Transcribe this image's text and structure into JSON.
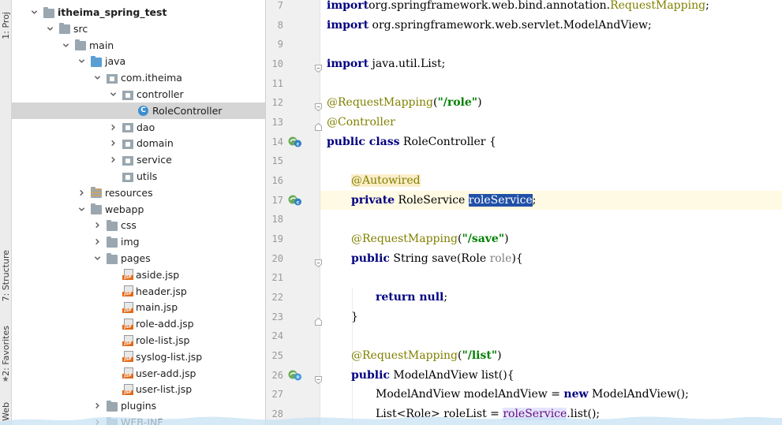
{
  "toolstrip": {
    "project_tab": "1: Proj",
    "structure_tab": "7: Structure",
    "favorites_tab": "2: Favorites",
    "web_tab": "Web"
  },
  "tree": {
    "items": [
      {
        "label": "itheima_spring_test",
        "level": 0,
        "chevron": "down",
        "icon": "module-folder",
        "bold": true
      },
      {
        "label": "src",
        "level": 1,
        "chevron": "down",
        "icon": "folder"
      },
      {
        "label": "main",
        "level": 2,
        "chevron": "down",
        "icon": "folder"
      },
      {
        "label": "java",
        "level": 3,
        "chevron": "down",
        "icon": "source-folder"
      },
      {
        "label": "com.itheima",
        "level": 4,
        "chevron": "down",
        "icon": "package"
      },
      {
        "label": "controller",
        "level": 5,
        "chevron": "down",
        "icon": "package"
      },
      {
        "label": "RoleController",
        "level": 6,
        "chevron": "none",
        "icon": "class",
        "selected": true
      },
      {
        "label": "dao",
        "level": 5,
        "chevron": "right",
        "icon": "package"
      },
      {
        "label": "domain",
        "level": 5,
        "chevron": "right",
        "icon": "package"
      },
      {
        "label": "service",
        "level": 5,
        "chevron": "right",
        "icon": "package"
      },
      {
        "label": "utils",
        "level": 5,
        "chevron": "none",
        "icon": "package"
      },
      {
        "label": "resources",
        "level": 3,
        "chevron": "right",
        "icon": "resources-folder"
      },
      {
        "label": "webapp",
        "level": 3,
        "chevron": "down",
        "icon": "web-folder"
      },
      {
        "label": "css",
        "level": 4,
        "chevron": "right",
        "icon": "folder"
      },
      {
        "label": "img",
        "level": 4,
        "chevron": "right",
        "icon": "folder"
      },
      {
        "label": "pages",
        "level": 4,
        "chevron": "down",
        "icon": "folder"
      },
      {
        "label": "aside.jsp",
        "level": 5,
        "chevron": "none",
        "icon": "jsp"
      },
      {
        "label": "header.jsp",
        "level": 5,
        "chevron": "none",
        "icon": "jsp"
      },
      {
        "label": "main.jsp",
        "level": 5,
        "chevron": "none",
        "icon": "jsp"
      },
      {
        "label": "role-add.jsp",
        "level": 5,
        "chevron": "none",
        "icon": "jsp"
      },
      {
        "label": "role-list.jsp",
        "level": 5,
        "chevron": "none",
        "icon": "jsp"
      },
      {
        "label": "syslog-list.jsp",
        "level": 5,
        "chevron": "none",
        "icon": "jsp"
      },
      {
        "label": "user-add.jsp",
        "level": 5,
        "chevron": "none",
        "icon": "jsp"
      },
      {
        "label": "user-list.jsp",
        "level": 5,
        "chevron": "none",
        "icon": "jsp"
      },
      {
        "label": "plugins",
        "level": 4,
        "chevron": "right",
        "icon": "folder"
      },
      {
        "label": "WEB-INF",
        "level": 4,
        "chevron": "right",
        "icon": "folder"
      }
    ]
  },
  "editor": {
    "lines": [
      {
        "n": "7",
        "indent": 0,
        "tokens": [
          [
            "kw",
            "import"
          ],
          [
            "",
            "org.springframework.web.bind.annotation."
          ],
          [
            "ann",
            "RequestMapping"
          ],
          [
            "",
            ";"
          ]
        ]
      },
      {
        "n": "8",
        "indent": 0,
        "tokens": [
          [
            "kw",
            "import"
          ],
          [
            "",
            " org.springframework.web.servlet.ModelAndView;"
          ]
        ]
      },
      {
        "n": "9",
        "indent": 0,
        "tokens": []
      },
      {
        "n": "10",
        "indent": 0,
        "fold": "start",
        "tokens": [
          [
            "kw",
            "import"
          ],
          [
            "",
            " java.util.List;"
          ]
        ]
      },
      {
        "n": "11",
        "indent": 0,
        "tokens": []
      },
      {
        "n": "12",
        "indent": 0,
        "fold": "start",
        "tokens": [
          [
            "ann",
            "@RequestMapping"
          ],
          [
            "",
            "("
          ],
          [
            "str",
            "\"/role\""
          ],
          [
            "",
            ")"
          ]
        ]
      },
      {
        "n": "13",
        "indent": 0,
        "fold": "end",
        "tokens": [
          [
            "ann",
            "@Controller"
          ]
        ]
      },
      {
        "n": "14",
        "indent": 0,
        "marker": "bean",
        "tokens": [
          [
            "kw",
            "public class"
          ],
          [
            "",
            " RoleController {"
          ]
        ]
      },
      {
        "n": "15",
        "indent": 0,
        "tokens": []
      },
      {
        "n": "16",
        "indent": 1,
        "tokens": [
          [
            "autowired",
            "@Autowired"
          ]
        ]
      },
      {
        "n": "17",
        "indent": 1,
        "marker": "bean",
        "highlight": true,
        "tokens": [
          [
            "kw",
            "private"
          ],
          [
            "",
            " RoleService "
          ],
          [
            "sel",
            "roleService"
          ],
          [
            "",
            ";"
          ]
        ]
      },
      {
        "n": "18",
        "indent": 0,
        "tokens": []
      },
      {
        "n": "19",
        "indent": 1,
        "tokens": [
          [
            "ann",
            "@RequestMapping"
          ],
          [
            "",
            "("
          ],
          [
            "str",
            "\"/save\""
          ],
          [
            "",
            ")"
          ]
        ]
      },
      {
        "n": "20",
        "indent": 1,
        "fold": "start",
        "tokens": [
          [
            "kw",
            "public"
          ],
          [
            "",
            " String save(Role "
          ],
          [
            "param",
            "role"
          ],
          [
            "",
            "){"
          ]
        ]
      },
      {
        "n": "21",
        "indent": 0,
        "tokens": []
      },
      {
        "n": "22",
        "indent": 2,
        "tokens": [
          [
            "kw",
            "return null"
          ],
          [
            "",
            ";"
          ]
        ]
      },
      {
        "n": "23",
        "indent": 1,
        "fold": "end",
        "tokens": [
          [
            "",
            "}"
          ]
        ]
      },
      {
        "n": "24",
        "indent": 0,
        "tokens": []
      },
      {
        "n": "25",
        "indent": 1,
        "tokens": [
          [
            "ann",
            "@RequestMapping"
          ],
          [
            "",
            "("
          ],
          [
            "str",
            "\"/list\""
          ],
          [
            "",
            ")"
          ]
        ]
      },
      {
        "n": "26",
        "indent": 1,
        "marker": "web",
        "fold": "start",
        "tokens": [
          [
            "kw",
            "public"
          ],
          [
            "",
            " ModelAndView list(){"
          ]
        ]
      },
      {
        "n": "27",
        "indent": 2,
        "tokens": [
          [
            "",
            "ModelAndView modelAndView = "
          ],
          [
            "kw",
            "new"
          ],
          [
            "",
            " ModelAndView();"
          ]
        ]
      },
      {
        "n": "28",
        "indent": 2,
        "tokens": [
          [
            "",
            "List<Role> roleList = "
          ],
          [
            "fieldhl",
            "roleService"
          ],
          [
            "",
            ".list();"
          ]
        ]
      }
    ]
  }
}
